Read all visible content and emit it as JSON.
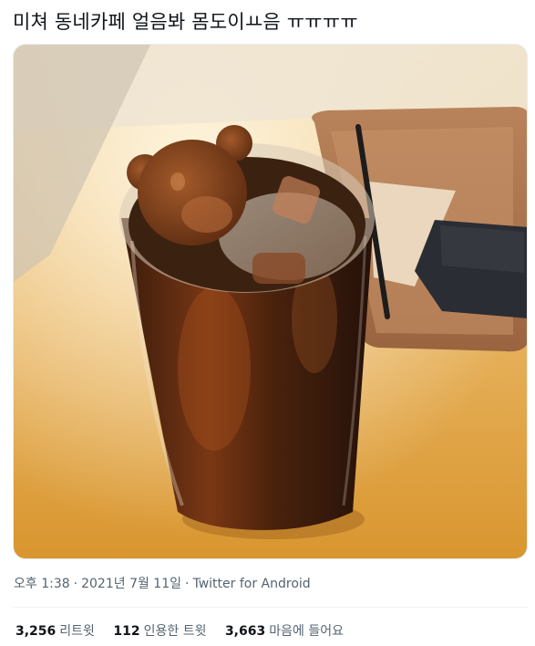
{
  "tweet": {
    "text": "미쳐 동네카페 얼음봐 몸도이ㅛ음 ㅠㅠㅠㅠ",
    "media": {
      "image_description": "photo"
    },
    "time": "오후 1:38",
    "date": "2021년 7월 11일",
    "source": "Twitter for Android",
    "separator": "·",
    "stats": {
      "retweets_count": "3,256",
      "retweets_label": "리트윗",
      "quotes_count": "112",
      "quotes_label": "인용한 트윗",
      "likes_count": "3,663",
      "likes_label": "마음에 들어요"
    }
  },
  "colors": {
    "text_primary": "#0f1419",
    "text_secondary": "#536471",
    "divider": "#eff3f4"
  }
}
